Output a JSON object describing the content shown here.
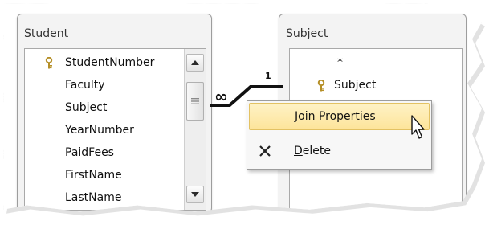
{
  "tables": {
    "student": {
      "title": "Student",
      "fields": [
        "StudentNumber",
        "Faculty",
        "Subject",
        "YearNumber",
        "PaidFees",
        "FirstName",
        "LastName"
      ]
    },
    "subject": {
      "title": "Subject",
      "fields": [
        "*",
        "Subject"
      ]
    }
  },
  "relationship": {
    "many_label": "∞",
    "one_label": "1"
  },
  "context_menu": {
    "items": [
      {
        "label": "Join Properties",
        "icon": "none"
      },
      {
        "label": "Delete",
        "icon": "close-icon"
      }
    ]
  },
  "colors": {
    "menu_highlight": "#fde49a",
    "key_icon": "#d4b04a"
  }
}
